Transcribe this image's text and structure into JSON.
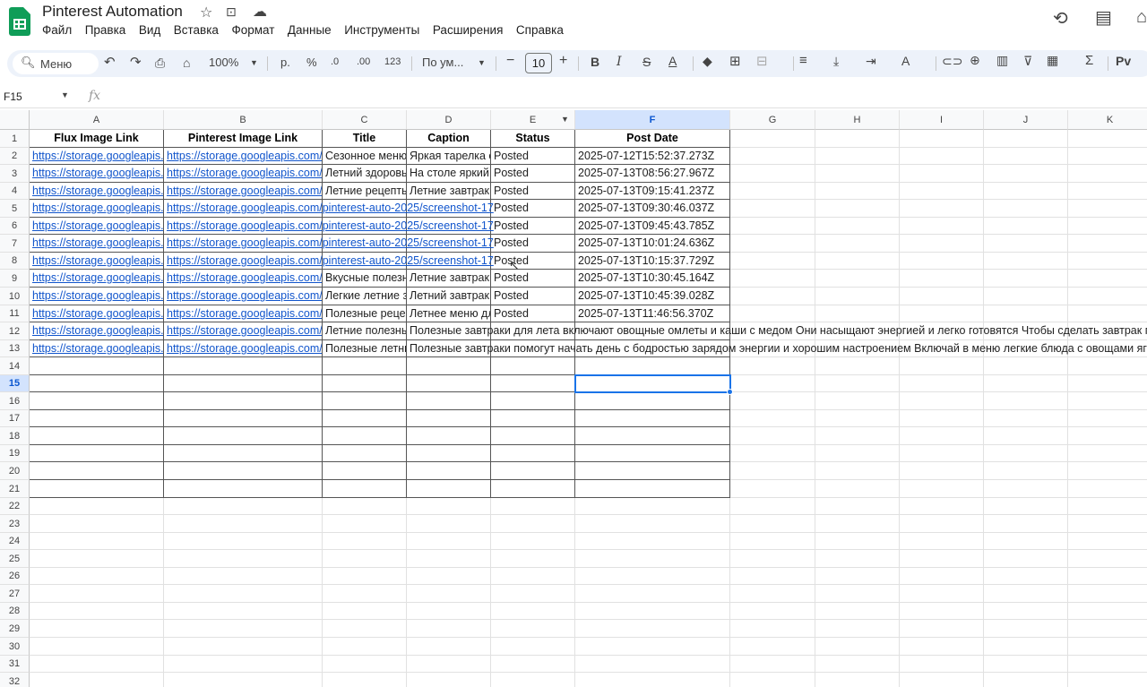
{
  "app": {
    "doc_title": "Pinterest Automation",
    "menu": [
      "Файл",
      "Правка",
      "Вид",
      "Вставка",
      "Формат",
      "Данные",
      "Инструменты",
      "Расширения",
      "Справка"
    ],
    "icons": [
      "star-icon",
      "move-folder-icon",
      "cloud-status-icon",
      "history-icon",
      "comments-icon"
    ]
  },
  "toolbar": {
    "search_label": "Меню",
    "zoom": "100%",
    "currency": "р.",
    "percent": "%",
    "decrease_decimals": ".0",
    "increase_decimals": ".00",
    "number_format": "123",
    "font": "По ум...",
    "font_size": "10",
    "bold": "B",
    "italic": "I",
    "strike": "S",
    "text_color": "A",
    "sum": "Σ"
  },
  "formula_bar": {
    "cell_ref": "F15",
    "fx": "fx",
    "value": ""
  },
  "sheet": {
    "column_letters": [
      "A",
      "B",
      "C",
      "D",
      "E",
      "F",
      "G",
      "H",
      "I",
      "J",
      "K"
    ],
    "selected_column": "F",
    "selected_row": 15,
    "row_numbers": [
      1,
      2,
      3,
      4,
      5,
      6,
      7,
      8,
      9,
      10,
      11,
      12,
      13,
      14,
      15,
      16,
      17,
      18,
      19,
      20,
      21,
      22,
      23,
      24,
      25,
      26,
      27,
      28,
      29,
      30,
      31,
      32
    ],
    "headers": [
      "Flux Image Link",
      "Pinterest Image Link",
      "Title",
      "Caption",
      "Status",
      "Post Date"
    ],
    "rows": [
      [
        "https://storage.googleapis.",
        "https://storage.googleapis.com/",
        "Сезонное меню",
        "Яркая тарелка с",
        "Posted",
        "2025-07-12T15:52:37.273Z"
      ],
      [
        "https://storage.googleapis.",
        "https://storage.googleapis.com/",
        "Летний здоровь",
        "На столе яркий",
        "Posted",
        "2025-07-13T08:56:27.967Z"
      ],
      [
        "https://storage.googleapis.",
        "https://storage.googleapis.com/",
        "Летние рецепты",
        "Летние завтрак",
        "Posted",
        "2025-07-13T09:15:41.237Z"
      ],
      [
        "https://storage.googleapis.",
        "https://storage.googleapis.com/pinterest-auto-2025/screenshot-17",
        "",
        "",
        "Posted",
        "2025-07-13T09:30:46.037Z"
      ],
      [
        "https://storage.googleapis.",
        "https://storage.googleapis.com/pinterest-auto-2025/screenshot-17",
        "",
        "",
        "Posted",
        "2025-07-13T09:45:43.785Z"
      ],
      [
        "https://storage.googleapis.",
        "https://storage.googleapis.com/pinterest-auto-2025/screenshot-17",
        "",
        "",
        "Posted",
        "2025-07-13T10:01:24.636Z"
      ],
      [
        "https://storage.googleapis.",
        "https://storage.googleapis.com/pinterest-auto-2025/screenshot-17",
        "",
        "",
        "Posted",
        "2025-07-13T10:15:37.729Z"
      ],
      [
        "https://storage.googleapis.",
        "https://storage.googleapis.com/",
        "Вкусные полезн",
        "Летние завтрак",
        "Posted",
        "2025-07-13T10:30:45.164Z"
      ],
      [
        "https://storage.googleapis.",
        "https://storage.googleapis.com/",
        "Легкие летние з",
        "Летний завтрак",
        "Posted",
        "2025-07-13T10:45:39.028Z"
      ],
      [
        "https://storage.googleapis.",
        "https://storage.googleapis.com/",
        "Полезные реце",
        "Летнее меню дл",
        "Posted",
        "2025-07-13T11:46:56.370Z"
      ],
      [
        "https://storage.googleapis.",
        "https://storage.googleapis.com/",
        "Летние полезнь",
        "Полезные завтраки для лета включают овощные омлеты и каши с медом Они насыщают энергией и легко готовятся Чтобы сделать завтрак п",
        "",
        ""
      ],
      [
        "https://storage.googleapis.",
        "https://storage.googleapis.com/",
        "Полезные летни",
        "Полезные завтраки помогут начать день с бодростью зарядом энергии и хорошим настроением Включай в меню легкие блюда с овощами яго",
        "",
        ""
      ]
    ]
  }
}
